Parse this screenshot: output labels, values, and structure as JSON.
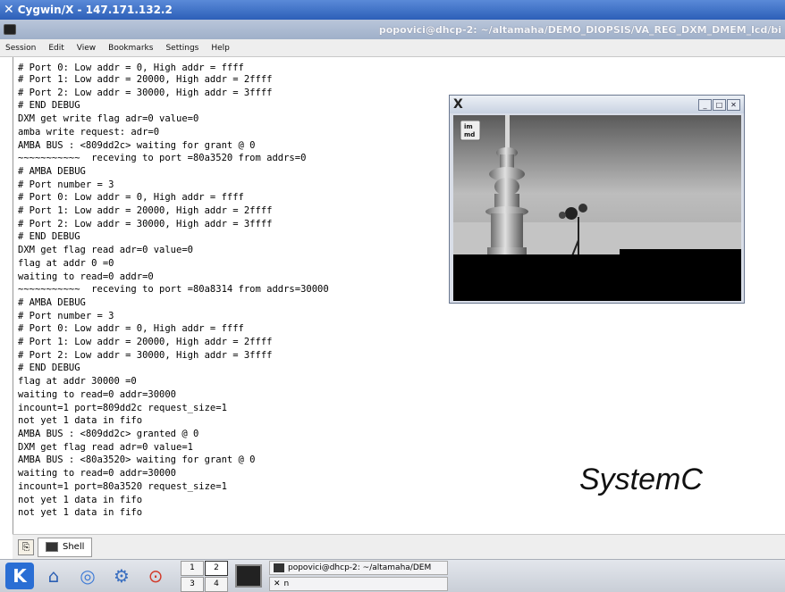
{
  "window": {
    "title": "Cygwin/X - 147.171.132.2"
  },
  "konsole": {
    "title_path": "popovici@dhcp-2: ~/altamaha/DEMO_DIOPSIS/VA_REG_DXM_DMEM_lcd/bi"
  },
  "menu": {
    "items": [
      "Session",
      "Edit",
      "View",
      "Bookmarks",
      "Settings",
      "Help"
    ]
  },
  "terminal": {
    "partial_top": "# Port 0: Low addr = 0, High addr = ffff",
    "lines": [
      "# Port 1: Low addr = 20000, High addr = 2ffff",
      "# Port 2: Low addr = 30000, High addr = 3ffff",
      "# END DEBUG",
      "DXM get write flag adr=0 value=0",
      "amba write request: adr=0",
      "AMBA BUS : <809dd2c> waiting for grant @ 0",
      "~~~~~~~~~~~  receving to port =80a3520 from addrs=0",
      "# AMBA DEBUG",
      "# Port number = 3",
      "# Port 0: Low addr = 0, High addr = ffff",
      "# Port 1: Low addr = 20000, High addr = 2ffff",
      "# Port 2: Low addr = 30000, High addr = 3ffff",
      "# END DEBUG",
      "DXM get flag read adr=0 value=0",
      "flag at addr 0 =0",
      "waiting to read=0 addr=0",
      "~~~~~~~~~~~  receving to port =80a8314 from addrs=30000",
      "# AMBA DEBUG",
      "# Port number = 3",
      "# Port 0: Low addr = 0, High addr = ffff",
      "# Port 1: Low addr = 20000, High addr = 2ffff",
      "# Port 2: Low addr = 30000, High addr = 3ffff",
      "# END DEBUG",
      "flag at addr 30000 =0",
      "waiting to read=0 addr=30000",
      "incount=1 port=809dd2c request_size=1",
      "not yet 1 data in fifo",
      "AMBA BUS : <809dd2c> granted @ 0",
      "DXM get flag read adr=0 value=1",
      "AMBA BUS : <80a3520> waiting for grant @ 0",
      "waiting to read=0 addr=30000",
      "incount=1 port=80a3520 request_size=1",
      "not yet 1 data in fifo",
      "not yet 1 data in fifo"
    ]
  },
  "viewer": {
    "title_icon": "X",
    "logo_text": "im md"
  },
  "overlay": {
    "label": "SystemC"
  },
  "tabbar": {
    "tab_label": "Shell"
  },
  "panel": {
    "pager": [
      "1",
      "2",
      "3",
      "4"
    ],
    "tasks": [
      "popovici@dhcp-2: ~/altamaha/DEM",
      "n"
    ]
  }
}
